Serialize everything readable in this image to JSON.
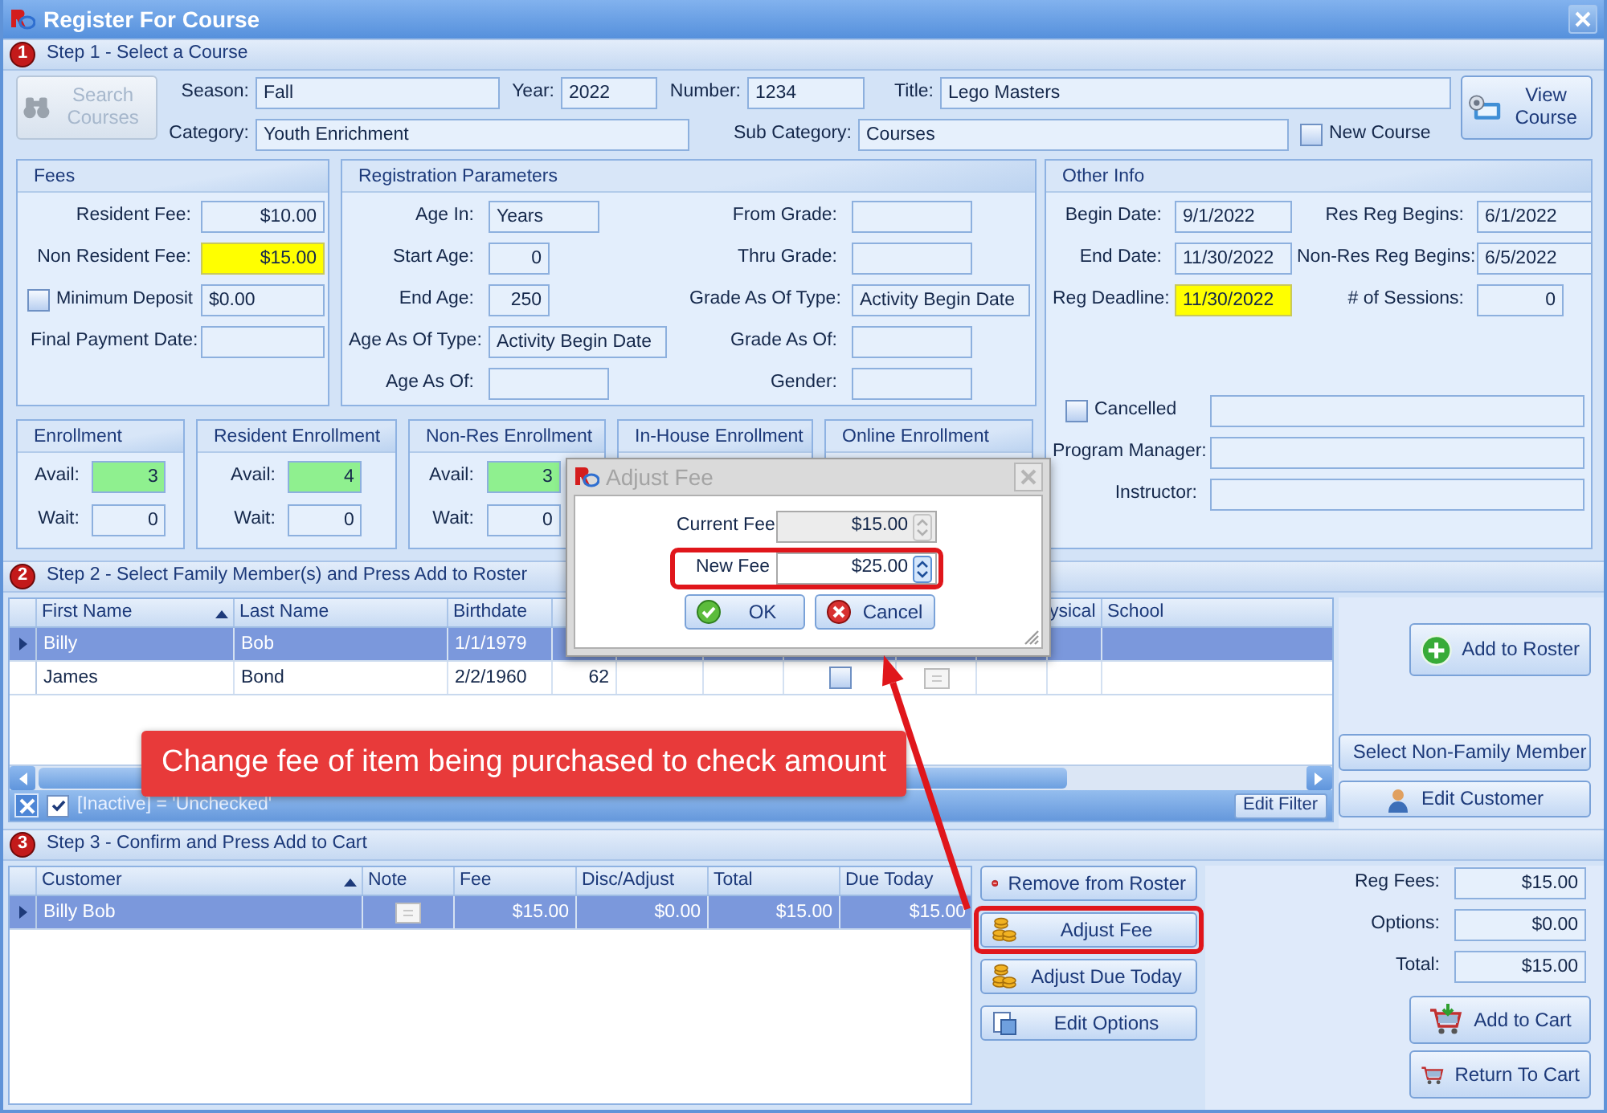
{
  "window": {
    "title": "Register For Course"
  },
  "step1": {
    "badge": "1",
    "title": "Step 1 - Select a Course",
    "search_button": {
      "label": "Search Courses",
      "disabled": true
    },
    "fields": [
      {
        "label": "Season:",
        "value": "Fall"
      },
      {
        "label": "Year:",
        "value": "2022"
      },
      {
        "label": "Number:",
        "value": "1234"
      },
      {
        "label": "Title:",
        "value": "Lego Masters"
      },
      {
        "label": "Category:",
        "value": "Youth Enrichment"
      },
      {
        "label": "Sub Category:",
        "value": "Courses"
      }
    ],
    "new_course": {
      "label": "New Course",
      "checked": false
    },
    "view_button": "View Course"
  },
  "fees": {
    "title": "Fees",
    "rows": [
      {
        "kind": "number",
        "label": "Resident Fee:",
        "value": "$10.00",
        "highlighted": false
      },
      {
        "kind": "number",
        "label": "Non Resident Fee:",
        "value": "$15.00",
        "highlighted": true
      },
      {
        "kind": "checkbox",
        "label": "Minimum Deposit",
        "checked": false,
        "value": "$0.00",
        "highlighted": false
      },
      {
        "kind": "text",
        "label": "Final Payment Date:",
        "highlighted": false
      }
    ]
  },
  "registration": {
    "title": "Registration Parameters",
    "left": [
      {
        "kind": "text",
        "label": "Age In:",
        "value": "Years"
      },
      {
        "kind": "number",
        "label": "Start Age:",
        "value": "0"
      },
      {
        "kind": "number",
        "label": "End Age:",
        "value": "250"
      },
      {
        "kind": "text",
        "label": "Age As Of Type:",
        "value": "Activity Begin Date"
      },
      {
        "label": "Age As Of:"
      }
    ],
    "right": [
      {
        "label": "From Grade:"
      },
      {
        "label": "Thru Grade:"
      },
      {
        "label": "Grade As Of Type:",
        "value": "Activity Begin Date"
      },
      {
        "label": "Grade As Of:"
      },
      {
        "label": "Gender:"
      }
    ]
  },
  "enrollment": [
    {
      "title": "Enrollment",
      "avail_label": "Avail:",
      "avail": "3",
      "wait_label": "Wait:",
      "wait": "0"
    },
    {
      "title": "Resident Enrollment",
      "avail_label": "Avail:",
      "avail": "4",
      "wait_label": "Wait:",
      "wait": "0"
    },
    {
      "title": "Non-Res Enrollment",
      "avail_label": "Avail:",
      "avail": "3",
      "wait_label": "Wait:",
      "wait": "0"
    },
    {
      "title": "In-House Enrollment"
    },
    {
      "title": "Online Enrollment"
    }
  ],
  "other_info": {
    "title": "Other Info",
    "rows": [
      {
        "kind": "text",
        "label": "Begin Date:",
        "value": "9/1/2022",
        "highlighted": false
      },
      {
        "kind": "text",
        "label": "Res Reg Begins:",
        "value": "6/1/2022",
        "highlighted": false
      },
      {
        "kind": "text",
        "label": "End Date:",
        "value": "11/30/2022",
        "highlighted": false
      },
      {
        "kind": "text",
        "label": "Non-Res Reg Begins:",
        "value": "6/5/2022",
        "highlighted": false
      },
      {
        "kind": "text",
        "label": "Reg Deadline:",
        "value": "11/30/2022",
        "highlighted": true
      },
      {
        "kind": "number",
        "label": "# of Sessions:",
        "value": "0",
        "highlighted": false
      }
    ],
    "cancelled": {
      "label": "Cancelled",
      "checked": false
    },
    "people": [
      {
        "label": "Program Manager:"
      },
      {
        "label": "Instructor:"
      }
    ]
  },
  "step2": {
    "badge": "2",
    "title": "Step 2 - Select  Family Member(s) and Press Add to Roster",
    "columns": [
      {
        "label": "First Name",
        "sorted": true
      },
      {
        "label": "Last Name",
        "sorted": false
      },
      {
        "label": "Birthdate",
        "sorted": false
      },
      {
        "label": "ysical"
      },
      {
        "label": "School",
        "sorted": false
      }
    ],
    "rows": [
      {
        "selected": true,
        "first_name": "Billy",
        "last_name": "Bob",
        "birthdate": "1/1/1979"
      },
      {
        "selected": false,
        "first_name": "James",
        "last_name": "Bond",
        "birthdate": "2/2/1960",
        "age": "62",
        "checked": false,
        "has_note": true
      }
    ],
    "filter": {
      "active": true,
      "text": "[Inactive] = 'Unchecked'",
      "edit_button": "Edit Filter"
    },
    "buttons": [
      "Add to Roster",
      "Select Non-Family Member",
      "Edit Customer"
    ]
  },
  "step3": {
    "badge": "3",
    "title": "Step 3 - Confirm and Press Add to Cart",
    "columns": [
      {
        "label": "Customer",
        "sorted": true
      },
      {
        "label": "Note",
        "sorted": false
      },
      {
        "label": "Fee",
        "sorted": false
      },
      {
        "label": "Disc/Adjust",
        "sorted": false
      },
      {
        "label": "Total",
        "sorted": false
      },
      {
        "label": "Due Today",
        "sorted": false
      }
    ],
    "rows": [
      {
        "selected": true,
        "customer": "Billy Bob",
        "has_note": true,
        "fee": "$15.00",
        "disc_adjust": "$0.00",
        "total": "$15.00",
        "due_today": "$15.00"
      }
    ],
    "actions": [
      {
        "kind": "remove",
        "label": "Remove from Roster",
        "highlighted": false
      },
      {
        "kind": "coins",
        "label": "Adjust Fee",
        "highlighted": true
      },
      {
        "kind": "coins",
        "label": "Adjust Due Today",
        "highlighted": false
      },
      {
        "kind": "options",
        "label": "Edit Options",
        "highlighted": false
      }
    ],
    "totals": [
      {
        "label": "Reg Fees:",
        "value": "$15.00"
      },
      {
        "label": "Options:",
        "value": "$0.00"
      },
      {
        "label": "Total:",
        "value": "$15.00"
      }
    ],
    "cart_buttons": [
      {
        "kind": "add",
        "label": "Add to Cart"
      },
      {
        "kind": "return",
        "label": "Return To Cart"
      }
    ]
  },
  "dialog": {
    "title": "Adjust Fee",
    "fields": [
      {
        "label": "Current Fee",
        "value": "$15.00",
        "disabled": true,
        "highlighted": false
      },
      {
        "label": "New Fee",
        "value": "$25.00",
        "disabled": false,
        "highlighted": true
      }
    ],
    "buttons": [
      {
        "kind": "ok",
        "label": "OK"
      },
      {
        "kind": "cancel",
        "label": "Cancel"
      }
    ]
  },
  "callout": {
    "text": "Change fee of item being purchased to check amount"
  }
}
